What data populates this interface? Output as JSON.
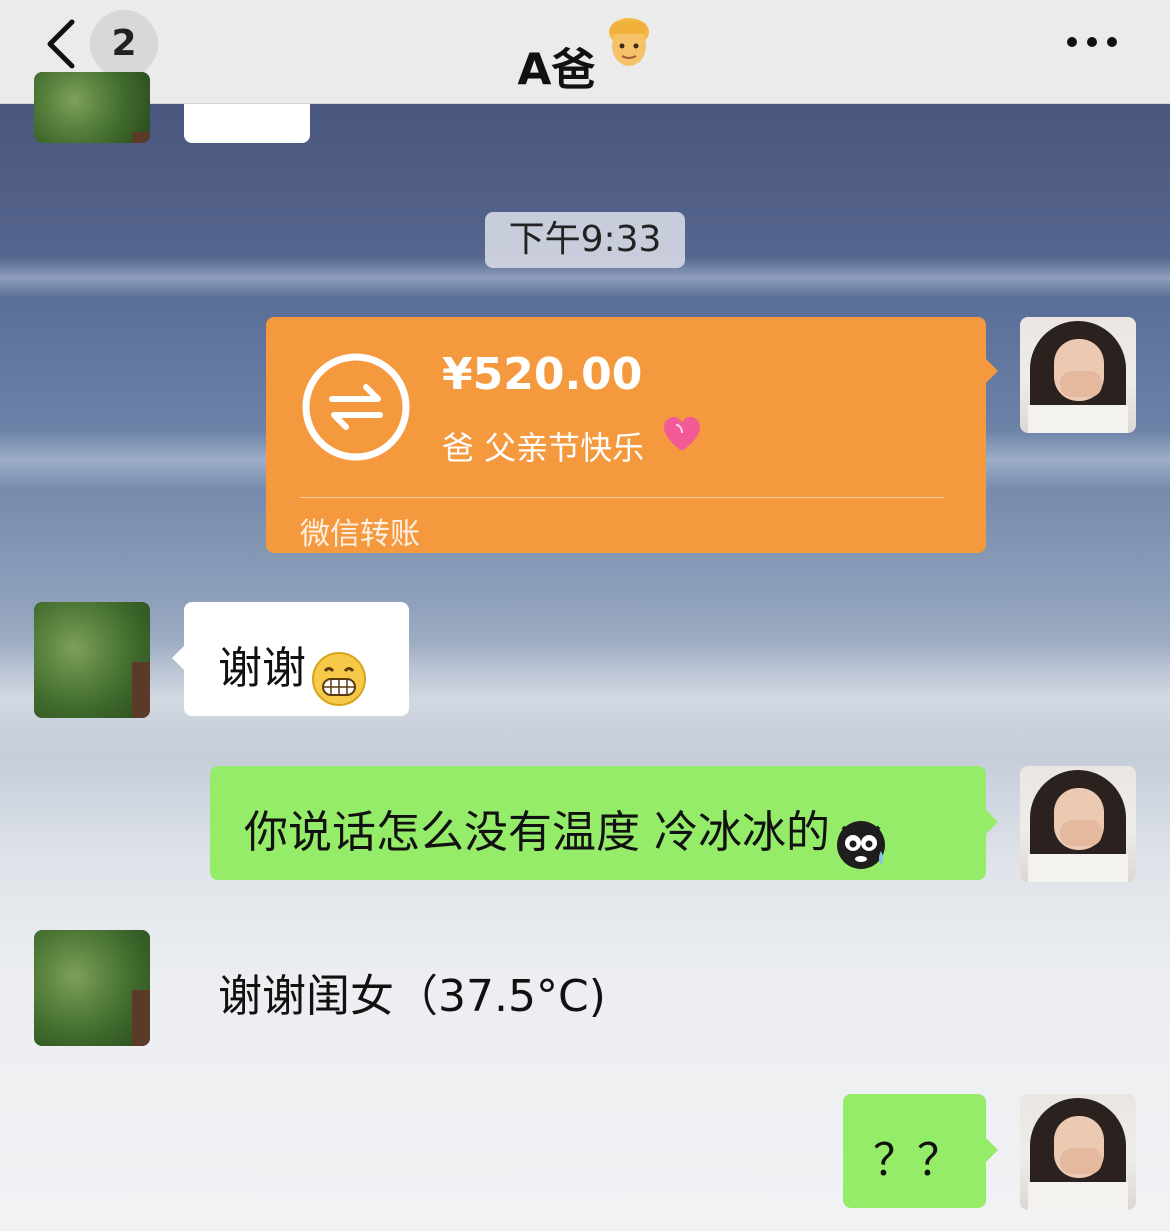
{
  "header": {
    "back_label": "back",
    "unread_count": "2",
    "title": "A爸",
    "title_emoji": "man-emoji",
    "more_icon": "more-dots-icon"
  },
  "chat": {
    "timestamp": "下午9:33",
    "transfer": {
      "amount": "¥520.00",
      "note": "爸 父亲节快乐",
      "note_emoji": "heart-emoji",
      "label": "微信转账",
      "color": "#f5993e"
    },
    "messages": [
      {
        "sender": "dad",
        "text": "谢谢",
        "emoji": "grin-emoji"
      },
      {
        "sender": "me",
        "text": "你说话怎么没有温度 冷冰冰的",
        "emoji": "freezing-emoji"
      },
      {
        "sender": "dad",
        "text": "谢谢闺女（37.5°C)"
      },
      {
        "sender": "me",
        "text": "？？"
      }
    ],
    "colors": {
      "green_bubble": "#95ec69",
      "white_bubble": "#ffffff"
    }
  }
}
